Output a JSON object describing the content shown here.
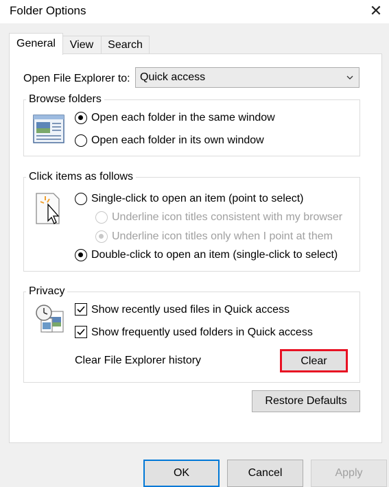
{
  "window": {
    "title": "Folder Options"
  },
  "tabs": [
    {
      "label": "General",
      "active": true
    },
    {
      "label": "View",
      "active": false
    },
    {
      "label": "Search",
      "active": false
    }
  ],
  "open_to": {
    "label": "Open File Explorer to:",
    "value": "Quick access"
  },
  "browse_folders": {
    "legend": "Browse folders",
    "options": [
      {
        "label": "Open each folder in the same window",
        "checked": true
      },
      {
        "label": "Open each folder in its own window",
        "checked": false
      }
    ]
  },
  "click_items": {
    "legend": "Click items as follows",
    "single": {
      "label": "Single-click to open an item (point to select)",
      "checked": false
    },
    "underline_browser": {
      "label": "Underline icon titles consistent with my browser",
      "checked": false,
      "disabled": true
    },
    "underline_point": {
      "label": "Underline icon titles only when I point at them",
      "checked": true,
      "disabled": true
    },
    "double": {
      "label": "Double-click to open an item (single-click to select)",
      "checked": true
    }
  },
  "privacy": {
    "legend": "Privacy",
    "recent_files": {
      "label": "Show recently used files in Quick access",
      "checked": true
    },
    "frequent_folders": {
      "label": "Show frequently used folders in Quick access",
      "checked": true
    },
    "clear_label": "Clear File Explorer history",
    "clear_button": "Clear"
  },
  "restore_defaults": "Restore Defaults",
  "footer": {
    "ok": "OK",
    "cancel": "Cancel",
    "apply": "Apply"
  },
  "colors": {
    "highlight": "#e81123",
    "accent": "#0078d7"
  }
}
